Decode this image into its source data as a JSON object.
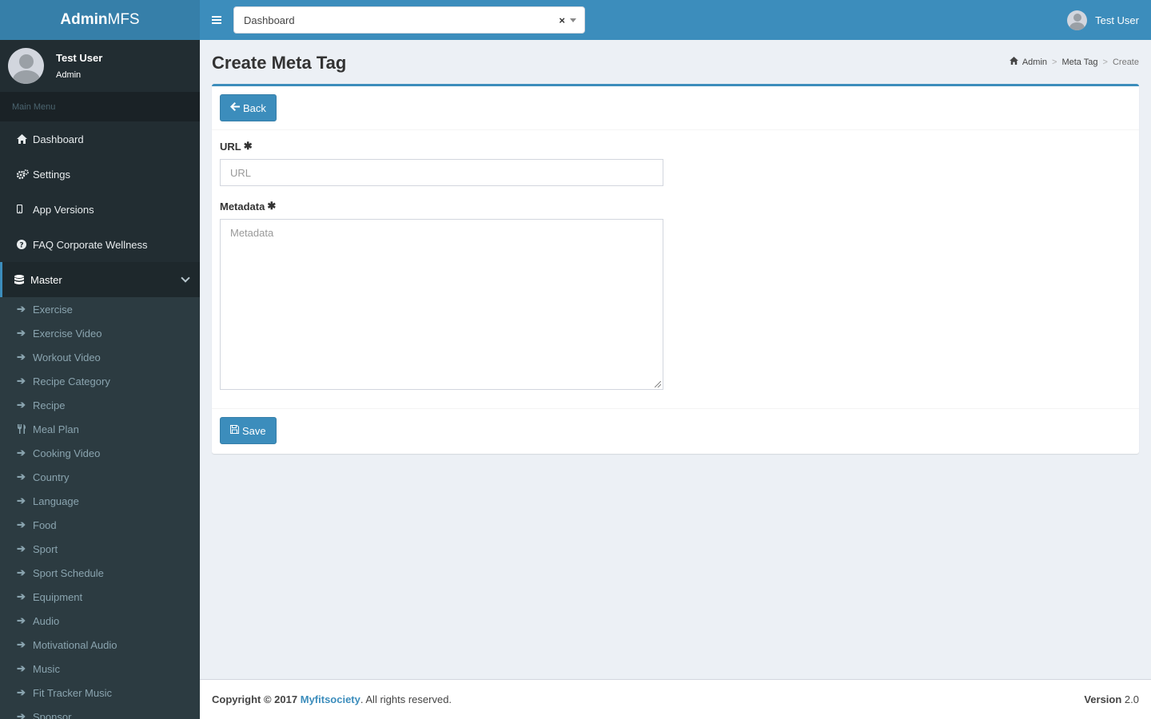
{
  "brand": {
    "bold": "Admin",
    "light": "MFS"
  },
  "user": {
    "name": "Test User",
    "role": "Admin"
  },
  "sidebar": {
    "header": "Main Menu",
    "items": [
      {
        "label": "Dashboard",
        "icon": "home-icon"
      },
      {
        "label": "Settings",
        "icon": "cogs-icon"
      },
      {
        "label": "App Versions",
        "icon": "mobile-icon"
      },
      {
        "label": "FAQ Corporate Wellness",
        "icon": "question-circle-icon"
      },
      {
        "label": "Master",
        "icon": "database-icon"
      }
    ],
    "subitems": [
      {
        "label": "Exercise",
        "icon": "arrow-right-icon"
      },
      {
        "label": "Exercise Video",
        "icon": "arrow-right-icon"
      },
      {
        "label": "Workout Video",
        "icon": "arrow-right-icon"
      },
      {
        "label": "Recipe Category",
        "icon": "arrow-right-icon"
      },
      {
        "label": "Recipe",
        "icon": "arrow-right-icon"
      },
      {
        "label": "Meal Plan",
        "icon": "cutlery-icon"
      },
      {
        "label": "Cooking Video",
        "icon": "arrow-right-icon"
      },
      {
        "label": "Country",
        "icon": "arrow-right-icon"
      },
      {
        "label": "Language",
        "icon": "arrow-right-icon"
      },
      {
        "label": "Food",
        "icon": "arrow-right-icon"
      },
      {
        "label": "Sport",
        "icon": "arrow-right-icon"
      },
      {
        "label": "Sport Schedule",
        "icon": "arrow-right-icon"
      },
      {
        "label": "Equipment",
        "icon": "arrow-right-icon"
      },
      {
        "label": "Audio",
        "icon": "arrow-right-icon"
      },
      {
        "label": "Motivational Audio",
        "icon": "arrow-right-icon"
      },
      {
        "label": "Music",
        "icon": "arrow-right-icon"
      },
      {
        "label": "Fit Tracker Music",
        "icon": "arrow-right-icon"
      },
      {
        "label": "Sponsor",
        "icon": "arrow-right-icon"
      }
    ]
  },
  "topbar": {
    "select_value": "Dashboard",
    "clear": "×"
  },
  "page": {
    "title": "Create Meta Tag",
    "breadcrumb": [
      "Admin",
      "Meta Tag",
      "Create"
    ]
  },
  "form": {
    "back_label": "Back",
    "url_label": "URL",
    "url_placeholder": "URL",
    "metadata_label": "Metadata",
    "metadata_placeholder": "Metadata",
    "required_mark": "✱",
    "save_label": "Save"
  },
  "footer": {
    "copyright_prefix": "Copyright © 2017",
    "company": "Myfitsociety",
    "suffix": ". All rights reserved.",
    "version_label": "Version",
    "version": "2.0"
  },
  "colors": {
    "primary": "#3c8dbc",
    "logo_bg": "#367fa9",
    "sidebar_bg": "#222d32",
    "submenu_bg": "#2c3b41",
    "content_bg": "#ecf0f5"
  }
}
